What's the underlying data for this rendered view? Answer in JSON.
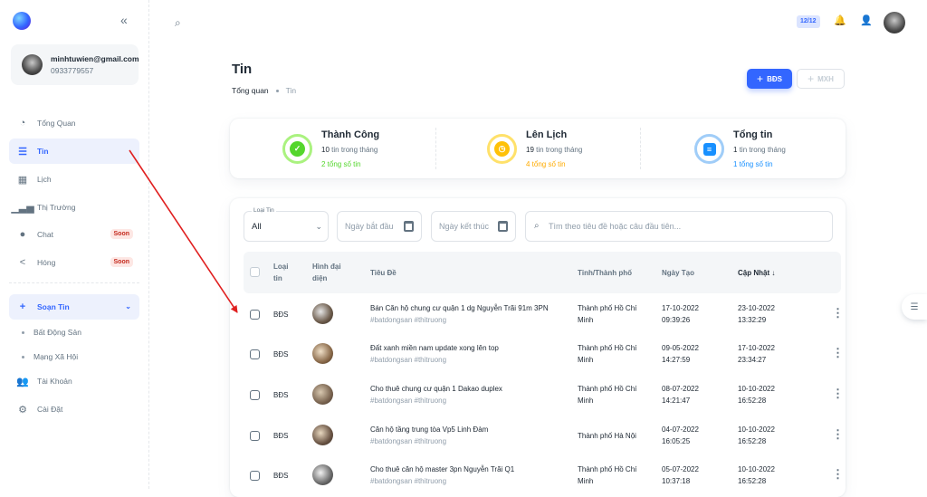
{
  "sidebar": {
    "account": {
      "email": "minhtuwien@gmail.com",
      "phone": "0933779557"
    },
    "items": [
      {
        "label": "Tổng Quan",
        "icon": "dashboard-icon"
      },
      {
        "label": "Tin",
        "icon": "list-icon",
        "active": true
      },
      {
        "label": "Lịch",
        "icon": "calendar-icon"
      },
      {
        "label": "Thị Trường",
        "icon": "chart-icon"
      },
      {
        "label": "Chat",
        "icon": "chat-icon",
        "badge": "Soon"
      },
      {
        "label": "Hóng",
        "icon": "share-icon",
        "badge": "Soon"
      }
    ],
    "compose": {
      "label": "Soạn Tin",
      "children": [
        "Bất Động Sản",
        "Mạng Xã Hội"
      ]
    },
    "account_item": "Tài Khoản",
    "settings_item": "Cài Đặt"
  },
  "topbar": {
    "badge": "12/12"
  },
  "page": {
    "title": "Tin",
    "breadcrumb": [
      "Tổng quan",
      "Tin"
    ],
    "primary_button": "BĐS",
    "secondary_button": "MXH"
  },
  "stats": [
    {
      "title": "Thành Công",
      "count": "10",
      "count_suffix": "tin trong tháng",
      "total": "2 tổng số tin",
      "color": "#54d62c"
    },
    {
      "title": "Lên Lịch",
      "count": "19",
      "count_suffix": "tin trong tháng",
      "total": "4 tổng số tin",
      "color": "#ffc107"
    },
    {
      "title": "Tổng tin",
      "count": "1",
      "count_suffix": "tin trong tháng",
      "total": "1 tổng số tin",
      "color": "#1890ff"
    }
  ],
  "filters": {
    "type_label": "Loại Tin",
    "type_value": "All",
    "start_date": "Ngày bắt đầu",
    "end_date": "Ngày kết thúc",
    "search_placeholder": "Tìm theo tiêu đề hoặc câu đầu tiên..."
  },
  "table": {
    "headers": {
      "type_line1": "Loại",
      "type_line2": "tin",
      "image_line1": "Hình đại",
      "image_line2": "diện",
      "title": "Tiêu Đề",
      "city": "Tỉnh/Thành phố",
      "created": "Ngày Tạo",
      "updated": "Cập Nhật ↓"
    },
    "rows": [
      {
        "type": "BĐS",
        "title": "Bán Căn hộ chung cư quận 1 dg Nguyễn Trãi 91m 3PN",
        "tags": "#batdongsan #thitruong",
        "city1": "Thành phố Hồ Chí",
        "city2": "Minh",
        "created_date": "17-10-2022",
        "created_time": "09:39:26",
        "updated_date": "23-10-2022",
        "updated_time": "13:32:29"
      },
      {
        "type": "BĐS",
        "title": "Đất xanh miền nam update xong lên top",
        "tags": "#batdongsan #thitruong",
        "city1": "Thành phố Hồ Chí",
        "city2": "Minh",
        "created_date": "09-05-2022",
        "created_time": "14:27:59",
        "updated_date": "17-10-2022",
        "updated_time": "23:34:27"
      },
      {
        "type": "BĐS",
        "title": "Cho thuê chung cư quận 1 Dakao duplex",
        "tags": "#batdongsan #thitruong",
        "city1": "Thành phố Hồ Chí",
        "city2": "Minh",
        "created_date": "08-07-2022",
        "created_time": "14:21:47",
        "updated_date": "10-10-2022",
        "updated_time": "16:52:28"
      },
      {
        "type": "BĐS",
        "title": "Căn hộ tầng trung tòa Vp5 Linh Đàm",
        "tags": "#batdongsan #thitruong",
        "city1": "Thành phố Hà Nội",
        "city2": "",
        "created_date": "04-07-2022",
        "created_time": "16:05:25",
        "updated_date": "10-10-2022",
        "updated_time": "16:52:28"
      },
      {
        "type": "BĐS",
        "title": "Cho thuê căn hộ master 3pn Nguyễn Trãi Q1",
        "tags": "#batdongsan #thitruong",
        "city1": "Thành phố Hồ Chí",
        "city2": "Minh",
        "created_date": "05-07-2022",
        "created_time": "10:37:18",
        "updated_date": "10-10-2022",
        "updated_time": "16:52:28"
      }
    ]
  },
  "colors": {
    "accent": "#3366ff",
    "annotation_arrow": "#e02020"
  }
}
